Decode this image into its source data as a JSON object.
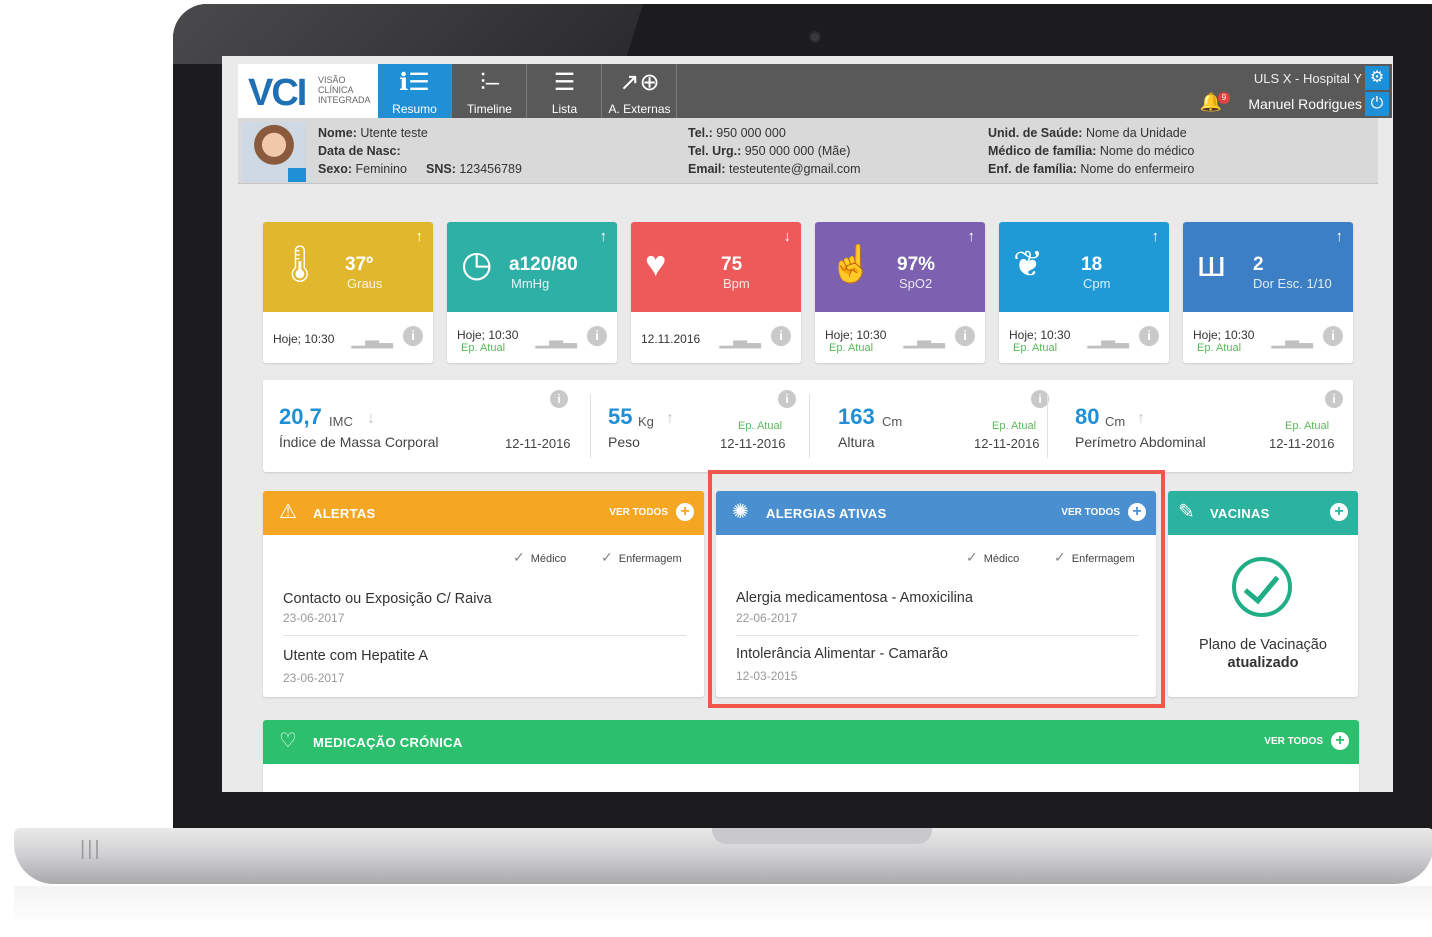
{
  "app": {
    "logo_text": "VCI",
    "logo_sub_1": "VISÃO",
    "logo_sub_2": "CLÍNICA",
    "logo_sub_3": "INTEGRADA"
  },
  "nav": [
    {
      "label": "Resumo",
      "icon": "resumo-icon",
      "active": true
    },
    {
      "label": "Timeline",
      "icon": "timeline-icon"
    },
    {
      "label": "Lista",
      "icon": "list-icon"
    },
    {
      "label": "A. Externas",
      "icon": "external-icon"
    }
  ],
  "header": {
    "hospital": "ULS X - Hospital Y",
    "user": "Manuel Rodrigues",
    "notifications": "9"
  },
  "patient": {
    "name_label": "Nome:",
    "name": "Utente teste",
    "dob_label": "Data de Nasc:",
    "dob": "",
    "sex_label": "Sexo:",
    "sex": "Feminino",
    "sns_label": "SNS:",
    "sns": "123456789",
    "tel_label": "Tel.:",
    "tel": "950 000 000",
    "telurg_label": "Tel. Urg.:",
    "telurg": "950 000 000 (Mãe)",
    "email_label": "Email:",
    "email": "testeutente@gmail.com",
    "unit_label": "Unid. de Saúde:",
    "unit": "Nome da Unidade",
    "doctor_label": "Médico de família:",
    "doctor": "Nome do médico",
    "nurse_label": "Enf. de família:",
    "nurse": "Nome do enfermeiro"
  },
  "vitals": [
    {
      "value": "37º",
      "unit": "Graus",
      "arrow": "↑",
      "date": "Hoje; 10:30",
      "sub": "",
      "color": "#e0b72d",
      "icon": "thermometer-icon"
    },
    {
      "value": "a120/80",
      "unit": "MmHg",
      "arrow": "↑",
      "date": "Hoje; 10:30",
      "sub": "Ep. Atual",
      "color": "#2fb0a6",
      "icon": "clock-icon"
    },
    {
      "value": "75",
      "unit": "Bpm",
      "arrow": "↓",
      "date": "12.11.2016",
      "sub": "",
      "color": "#ee5a5a",
      "icon": "heart-icon"
    },
    {
      "value": "97%",
      "unit": "SpO2",
      "arrow": "↑",
      "date": "Hoje; 10:30",
      "sub": "Ep. Atual",
      "color": "#7b61b0",
      "icon": "finger-icon"
    },
    {
      "value": "18",
      "unit": "Cpm",
      "arrow": "↑",
      "date": "Hoje; 10:30",
      "sub": "Ep. Atual",
      "color": "#1f9ad6",
      "icon": "lungs-icon"
    },
    {
      "value": "2",
      "unit": "Dor Esc. 1/10",
      "arrow": "↑",
      "date": "Hoje; 10:30",
      "sub": "Ep. Atual",
      "color": "#3d7fc4",
      "icon": "pain-scale-icon"
    }
  ],
  "measures": [
    {
      "value": "20,7",
      "unit": "IMC",
      "arrow": "↓",
      "label": "Índice de Massa Corporal",
      "ep": "",
      "date": "12-11-2016"
    },
    {
      "value": "55",
      "unit": "Kg",
      "arrow": "↑",
      "label": "Peso",
      "ep": "Ep. Atual",
      "date": "12-11-2016"
    },
    {
      "value": "163",
      "unit": "Cm",
      "arrow": "",
      "label": "Altura",
      "ep": "Ep. Atual",
      "date": "12-11-2016"
    },
    {
      "value": "80",
      "unit": "Cm",
      "arrow": "↑",
      "label": "Perímetro Abdominal",
      "ep": "Ep. Atual",
      "date": "12-11-2016"
    }
  ],
  "alertas": {
    "title": "ALERTAS",
    "see_all": "VER TODOS",
    "filter_medico": "Médico",
    "filter_enf": "Enfermagem",
    "items": [
      {
        "title": "Contacto ou Exposição C/ Raiva",
        "date": "23-06-2017"
      },
      {
        "title": "Utente com Hepatite A",
        "date": "23-06-2017"
      }
    ]
  },
  "alergias": {
    "title": "ALERGIAS ATIVAS",
    "see_all": "VER TODOS",
    "filter_medico": "Médico",
    "filter_enf": "Enfermagem",
    "items": [
      {
        "title": "Alergia medicamentosa - Amoxicilina",
        "date": "22-06-2017"
      },
      {
        "title": "Intolerância Alimentar - Camarão",
        "date": "12-03-2015"
      }
    ]
  },
  "vacinas": {
    "title": "VACINAS",
    "text1": "Plano de Vacinação",
    "text2": "atualizado"
  },
  "medicacao": {
    "title": "MEDICAÇÃO CRÓNICA",
    "see_all": "VER TODOS"
  },
  "colors": {
    "primary": "#1f8fd6",
    "alerts": "#f5a623",
    "allergies": "#4a8fd0",
    "vaccines": "#2bb3a0",
    "meds": "#2cbf6e",
    "highlight": "#f0574a"
  }
}
